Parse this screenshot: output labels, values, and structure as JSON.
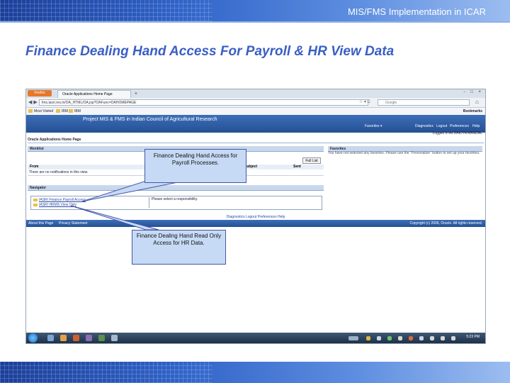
{
  "header": {
    "title": "MIS/FMS Implementation in ICAR"
  },
  "slide": {
    "title": "Finance Dealing Hand Access For Payroll & HR View Data"
  },
  "browser": {
    "app_button": "Firefox",
    "tab_title": "Oracle Applications Home Page",
    "tab_new": "+",
    "window_controls": "- □ ×",
    "nav_arrows": "◀ ▶",
    "url": "fms.iasri.res.in/OA_HTML/OA.jsp?OAFunc=OAHOMEPAGE",
    "url_tools": "☆ ▾ C",
    "search_placeholder": "Google",
    "bookmarks_toolbar": [
      {
        "label": "Most Visited"
      },
      {
        "label": "IBM"
      },
      {
        "label": "IBM"
      }
    ],
    "bookmarks_label": "Bookmarks"
  },
  "oracle": {
    "banner_title": "Project MIS & FMS in Indian Council of Agricultural Research",
    "menu": {
      "favorites": "Favorites ▾",
      "diagnostics": "Diagnostics",
      "logout": "Logout",
      "preferences": "Preferences",
      "help": "Help"
    },
    "logged_in": "Logged In As BAIDYA MANDAL",
    "page_title": "Oracle Applications Home Page",
    "worklist": {
      "heading": "Worklist",
      "full_list": "Full List",
      "columns": {
        "from": "From",
        "subject": "Subject",
        "sent": "Sent"
      },
      "empty_message": "There are no notifications in this view."
    },
    "favorites": {
      "heading": "Favorites",
      "message": "You have not selected any favorites. Please use the \"Personalize\" button to set up your favorites."
    },
    "navigator": {
      "heading": "Navigator",
      "responsibilities": [
        "IASRI Finance Payroll Access",
        "IASRI HRMS View Only"
      ],
      "select_message": "Please select a responsibility."
    },
    "footer_links": "Diagnostics   Logout   Preferences   Help",
    "footer_about": "About this Page",
    "footer_privacy": "Privacy Statement",
    "copyright": "Copyright (c) 2006, Oracle. All rights reserved."
  },
  "taskbar": {
    "clock": "5:23 PM"
  },
  "callouts": {
    "payroll": "Finance Dealing Hand Access for Payroll Processes.",
    "hr": "Finance Dealing Hand Read Only Access for HR Data."
  },
  "colors": {
    "accent": "#3a5fc4",
    "band": "#2f63c8",
    "callout_fill": "#c6daf5"
  }
}
